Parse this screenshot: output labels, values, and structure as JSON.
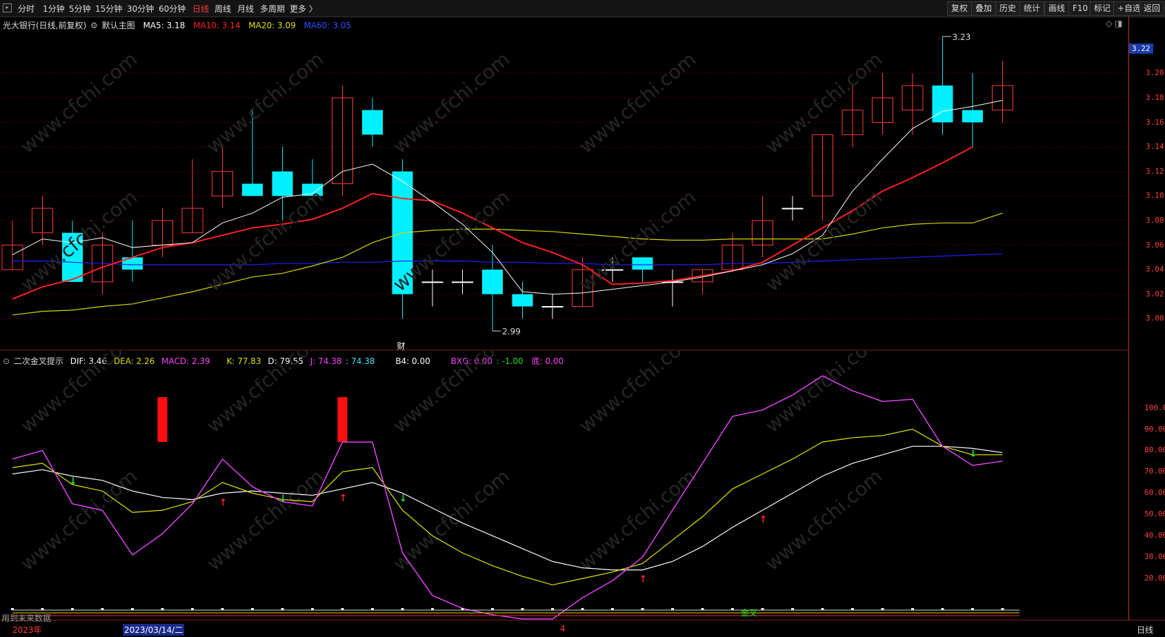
{
  "toolbar": {
    "periods": [
      "分时",
      "1分钟",
      "5分钟",
      "15分钟",
      "30分钟",
      "60分钟",
      "日线",
      "周线",
      "月线",
      "多周期",
      "更多 〉"
    ],
    "active_period": "日线",
    "right_buttons": [
      "复权",
      "叠加",
      "历史",
      "统计",
      "画线",
      "F10",
      "标记",
      "+自选",
      "返回"
    ]
  },
  "main_legend": {
    "stock": "光大银行(日线,前复权)",
    "chart_name": "默认主图",
    "ma5": "MA5: 3.18",
    "ma10": "MA10: 3.14",
    "ma20": "MA20: 3.09",
    "ma60": "MA60: 3.05"
  },
  "indicator_legend": {
    "name": "二次金叉提示",
    "dif": "DIF: 3.46",
    "dea": "DEA: 2.26",
    "macd": "MACD: 2.39",
    "k": "K: 77.83",
    "d": "D: 79.55",
    "j": "J: 74.38",
    "j2": ": 74.38",
    "b4": "B4: 0.00",
    "bxg": "BXG: 0.00",
    "bxg2": ": -1.00",
    "di": "底: 0.00"
  },
  "price_axis": {
    "current": "3.22",
    "ticks": [
      "3.20",
      "3.18",
      "3.16",
      "3.14",
      "3.12",
      "3.10",
      "3.08",
      "3.06",
      "3.04",
      "3.02",
      "3.00"
    ]
  },
  "indicator_axis": {
    "ticks": [
      "100.0",
      "90.00",
      "80.00",
      "70.00",
      "60.00",
      "50.00",
      "40.00",
      "30.00",
      "20.00"
    ]
  },
  "annotations": {
    "high": "3.23",
    "low": "2.99",
    "cai_marker": "财",
    "jincha_label": "金叉",
    "future_note": "用到未来数据"
  },
  "bottom_bar": {
    "year": "2023年",
    "date": "2023/03/14/二",
    "month": "4",
    "period_tab": "日线"
  },
  "colors": {
    "up": "#ff3b3b",
    "down": "#00f0ff",
    "ma5": "#ffffff",
    "ma10": "#ff2020",
    "ma20": "#d8d800",
    "ma60": "#2020ff",
    "k": "#ffffff",
    "d": "#e8e800",
    "j": "#ff33ff"
  },
  "chart_data": {
    "type": "candlestick",
    "price_range": [
      2.985,
      3.235
    ],
    "candles": [
      {
        "o": 3.04,
        "h": 3.08,
        "l": 3.04,
        "c": 3.06
      },
      {
        "o": 3.07,
        "h": 3.1,
        "l": 3.06,
        "c": 3.09
      },
      {
        "o": 3.07,
        "h": 3.08,
        "l": 3.03,
        "c": 3.03
      },
      {
        "o": 3.03,
        "h": 3.07,
        "l": 3.02,
        "c": 3.06
      },
      {
        "o": 3.05,
        "h": 3.08,
        "l": 3.03,
        "c": 3.04
      },
      {
        "o": 3.06,
        "h": 3.09,
        "l": 3.05,
        "c": 3.08
      },
      {
        "o": 3.07,
        "h": 3.13,
        "l": 3.07,
        "c": 3.09
      },
      {
        "o": 3.1,
        "h": 3.14,
        "l": 3.09,
        "c": 3.12
      },
      {
        "o": 3.11,
        "h": 3.17,
        "l": 3.1,
        "c": 3.1
      },
      {
        "o": 3.12,
        "h": 3.14,
        "l": 3.08,
        "c": 3.1
      },
      {
        "o": 3.11,
        "h": 3.13,
        "l": 3.1,
        "c": 3.1
      },
      {
        "o": 3.11,
        "h": 3.19,
        "l": 3.1,
        "c": 3.18
      },
      {
        "o": 3.17,
        "h": 3.18,
        "l": 3.14,
        "c": 3.15
      },
      {
        "o": 3.12,
        "h": 3.13,
        "l": 3.0,
        "c": 3.02
      },
      {
        "o": 3.03,
        "h": 3.04,
        "l": 3.01,
        "c": 3.03
      },
      {
        "o": 3.03,
        "h": 3.04,
        "l": 3.02,
        "c": 3.03
      },
      {
        "o": 3.04,
        "h": 3.06,
        "l": 2.99,
        "c": 3.02
      },
      {
        "o": 3.02,
        "h": 3.03,
        "l": 3.0,
        "c": 3.01
      },
      {
        "o": 3.01,
        "h": 3.02,
        "l": 3.0,
        "c": 3.01
      },
      {
        "o": 3.01,
        "h": 3.05,
        "l": 3.01,
        "c": 3.04
      },
      {
        "o": 3.04,
        "h": 3.05,
        "l": 3.03,
        "c": 3.04
      },
      {
        "o": 3.05,
        "h": 3.05,
        "l": 3.03,
        "c": 3.04
      },
      {
        "o": 3.03,
        "h": 3.04,
        "l": 3.01,
        "c": 3.03
      },
      {
        "o": 3.03,
        "h": 3.04,
        "l": 3.02,
        "c": 3.04
      },
      {
        "o": 3.04,
        "h": 3.07,
        "l": 3.04,
        "c": 3.06
      },
      {
        "o": 3.06,
        "h": 3.1,
        "l": 3.05,
        "c": 3.08
      },
      {
        "o": 3.09,
        "h": 3.1,
        "l": 3.08,
        "c": 3.09
      },
      {
        "o": 3.1,
        "h": 3.15,
        "l": 3.08,
        "c": 3.15
      },
      {
        "o": 3.15,
        "h": 3.19,
        "l": 3.14,
        "c": 3.17
      },
      {
        "o": 3.16,
        "h": 3.2,
        "l": 3.15,
        "c": 3.18
      },
      {
        "o": 3.17,
        "h": 3.2,
        "l": 3.15,
        "c": 3.19
      },
      {
        "o": 3.19,
        "h": 3.23,
        "l": 3.15,
        "c": 3.16
      },
      {
        "o": 3.17,
        "h": 3.2,
        "l": 3.14,
        "c": 3.16
      },
      {
        "o": 3.17,
        "h": 3.21,
        "l": 3.16,
        "c": 3.19
      }
    ],
    "ma5": [
      3.052,
      3.065,
      3.062,
      3.066,
      3.058,
      3.06,
      3.062,
      3.078,
      3.086,
      3.099,
      3.102,
      3.12,
      3.126,
      3.112,
      3.095,
      3.077,
      3.054,
      3.022,
      3.02,
      3.021,
      3.024,
      3.027,
      3.03,
      3.034,
      3.039,
      3.044,
      3.053,
      3.068,
      3.104,
      3.13,
      3.155,
      3.169,
      3.173,
      3.178
    ],
    "ma10": [
      3.016,
      3.026,
      3.032,
      3.042,
      3.05,
      3.058,
      3.062,
      3.068,
      3.074,
      3.077,
      3.081,
      3.09,
      3.102,
      3.098,
      3.096,
      3.086,
      3.074,
      3.062,
      3.054,
      3.044,
      3.028,
      3.029,
      3.031,
      3.035,
      3.039,
      3.046,
      3.06,
      3.074,
      3.088,
      3.104,
      3.115,
      3.127,
      3.14
    ],
    "ma20": [
      3.003,
      3.006,
      3.007,
      3.01,
      3.012,
      3.017,
      3.022,
      3.028,
      3.034,
      3.037,
      3.043,
      3.05,
      3.062,
      3.07,
      3.072,
      3.073,
      3.073,
      3.072,
      3.071,
      3.069,
      3.067,
      3.065,
      3.064,
      3.064,
      3.065,
      3.065,
      3.065,
      3.065,
      3.069,
      3.074,
      3.077,
      3.078,
      3.078,
      3.086
    ],
    "ma60": [
      3.047,
      3.047,
      3.046,
      3.045,
      3.044,
      3.044,
      3.044,
      3.044,
      3.044,
      3.045,
      3.045,
      3.046,
      3.046,
      3.047,
      3.047,
      3.047,
      3.046,
      3.046,
      3.045,
      3.045,
      3.044,
      3.044,
      3.044,
      3.044,
      3.045,
      3.045,
      3.046,
      3.047,
      3.048,
      3.049,
      3.05,
      3.051,
      3.052,
      3.053
    ],
    "kdj_range": [
      0,
      117
    ],
    "k": [
      69,
      71,
      68,
      66,
      61,
      58,
      57,
      60,
      61,
      60,
      59,
      62,
      65,
      60,
      53,
      46,
      40,
      34,
      28,
      25,
      24,
      24,
      28,
      35,
      44,
      52,
      60,
      68,
      74,
      78,
      82,
      82,
      81,
      79
    ],
    "d": [
      72,
      74,
      64,
      61,
      51,
      52,
      56,
      65,
      60,
      57,
      56,
      70,
      72,
      52,
      40,
      32,
      26,
      21,
      17,
      20,
      23,
      27,
      38,
      49,
      62,
      69,
      76,
      84,
      86,
      87,
      90,
      82,
      78,
      78
    ],
    "j": [
      76,
      80,
      55,
      52,
      31,
      41,
      55,
      76,
      63,
      56,
      54,
      84,
      84,
      32,
      12,
      6,
      3,
      1,
      1,
      11,
      19,
      30,
      52,
      74,
      96,
      99,
      106,
      115,
      108,
      103,
      104,
      82,
      73,
      75
    ],
    "macd_bars": [
      {
        "x": 5,
        "v": 1
      },
      {
        "x": 11,
        "v": 1
      }
    ],
    "up_arrows": [
      7,
      11,
      21,
      25
    ],
    "down_arrows": [
      2,
      9,
      13,
      32
    ]
  }
}
